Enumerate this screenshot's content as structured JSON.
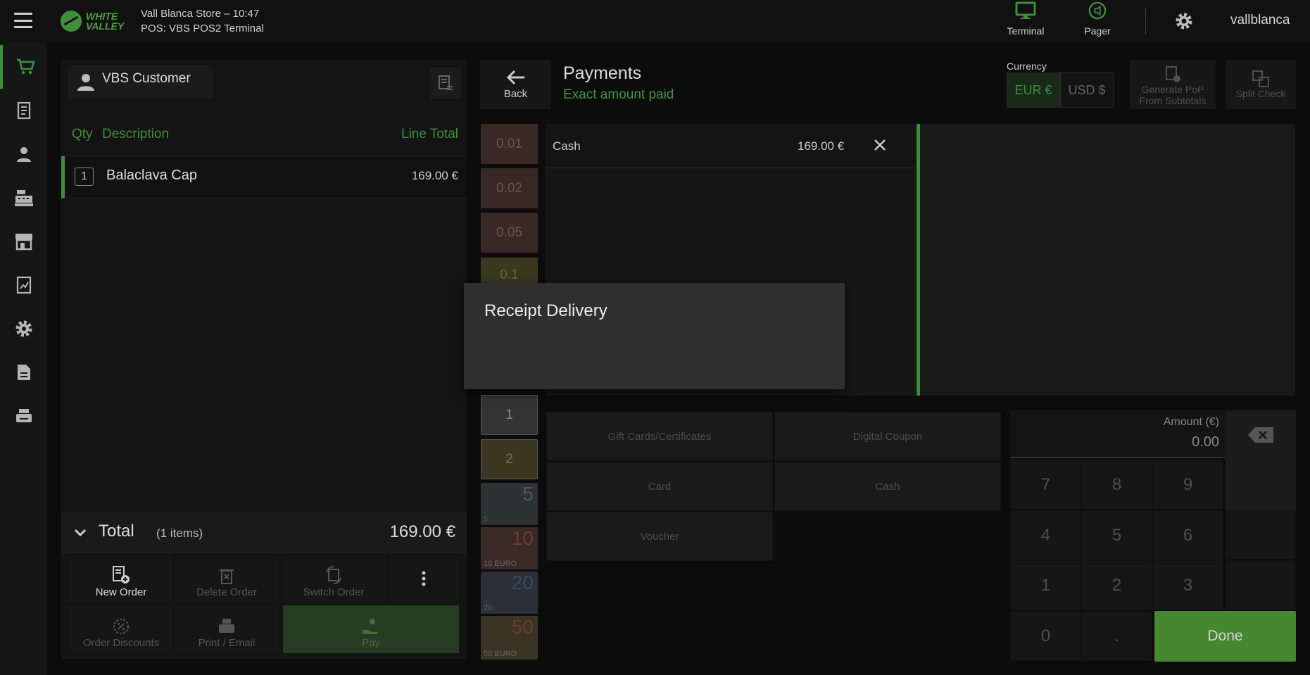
{
  "header": {
    "logo_text_line1": "WHITE",
    "logo_text_line2": "VALLEY",
    "store_line": "Vall Blanca Store – 10:47",
    "pos_line": "POS: VBS POS2 Terminal",
    "terminal_label": "Terminal",
    "pager_label": "Pager",
    "username": "vallblanca",
    "accent_color": "#3e8f3a"
  },
  "sidebar": {
    "items": [
      {
        "icon": "cart-icon",
        "active": true
      },
      {
        "icon": "receipt-icon"
      },
      {
        "icon": "person-icon"
      },
      {
        "icon": "cash-register-icon"
      },
      {
        "icon": "store-icon"
      },
      {
        "icon": "report-icon"
      },
      {
        "icon": "gear-icon"
      },
      {
        "icon": "document-icon"
      },
      {
        "icon": "printer-icon"
      }
    ]
  },
  "order": {
    "customer": "VBS Customer",
    "columns": {
      "qty": "Qty",
      "description": "Description",
      "line_total": "Line Total"
    },
    "lines": [
      {
        "qty": "1",
        "name": "Balaclava Cap",
        "total": "169.00 €"
      }
    ],
    "total_label": "Total",
    "total_items": "(1 items)",
    "total_amount": "169.00 €",
    "actions": {
      "new_order": "New Order",
      "delete_order": "Delete Order",
      "switch_order": "Switch Order",
      "order_discounts": "Order Discounts",
      "print_email": "Print / Email",
      "pay": "Pay"
    }
  },
  "payments": {
    "back_label": "Back",
    "title": "Payments",
    "subtitle": "Exact amount paid",
    "currency_label": "Currency",
    "currencies": [
      "EUR €",
      "USD $"
    ],
    "generate_pop_line1": "Generate PoP",
    "generate_pop_line2": "From Subtotals",
    "split_check": "Split Check",
    "denominations": [
      "0.01",
      "0.02",
      "0.05",
      "0.1",
      "1",
      "2",
      "5",
      "10",
      "20",
      "50"
    ],
    "note_corner_labels": [
      "5",
      "10 EURO",
      "20",
      "50 EURO"
    ],
    "lines": [
      {
        "method": "Cash",
        "amount": "169.00 €"
      }
    ],
    "methods": [
      "Gift Cards/Certificates",
      "Digital Coupon",
      "Card",
      "Cash",
      "Voucher"
    ],
    "amount_label": "Amount (€)",
    "amount_value": "0.00",
    "keypad": [
      "7",
      "8",
      "9",
      "4",
      "5",
      "6",
      "1",
      "2",
      "3",
      "0",
      "."
    ],
    "done_label": "Done"
  },
  "modal": {
    "title": "Receipt Delivery"
  }
}
